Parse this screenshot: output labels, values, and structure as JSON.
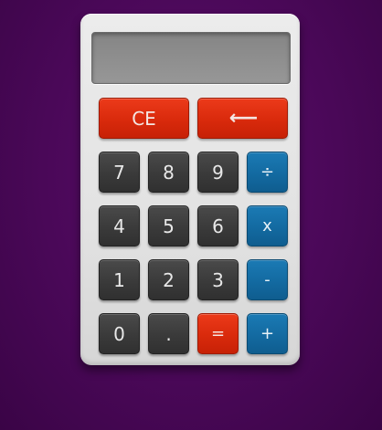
{
  "display": {
    "value": ""
  },
  "keys": {
    "clear_entry": "CE",
    "backspace": "⟵",
    "seven": "7",
    "eight": "8",
    "nine": "9",
    "divide": "÷",
    "four": "4",
    "five": "5",
    "six": "6",
    "multiply": "x",
    "one": "1",
    "two": "2",
    "three": "3",
    "subtract": "-",
    "zero": "0",
    "decimal": ".",
    "equals": "=",
    "add": "+"
  },
  "colors": {
    "background": "#4a0858",
    "body": "#e2e2e2",
    "display": "#8f8f8f",
    "number_key": "#3a3a3a",
    "function_key": "#d92a0c",
    "operator_key": "#136aa1"
  },
  "icons": {
    "backspace": "left-arrow-icon"
  }
}
